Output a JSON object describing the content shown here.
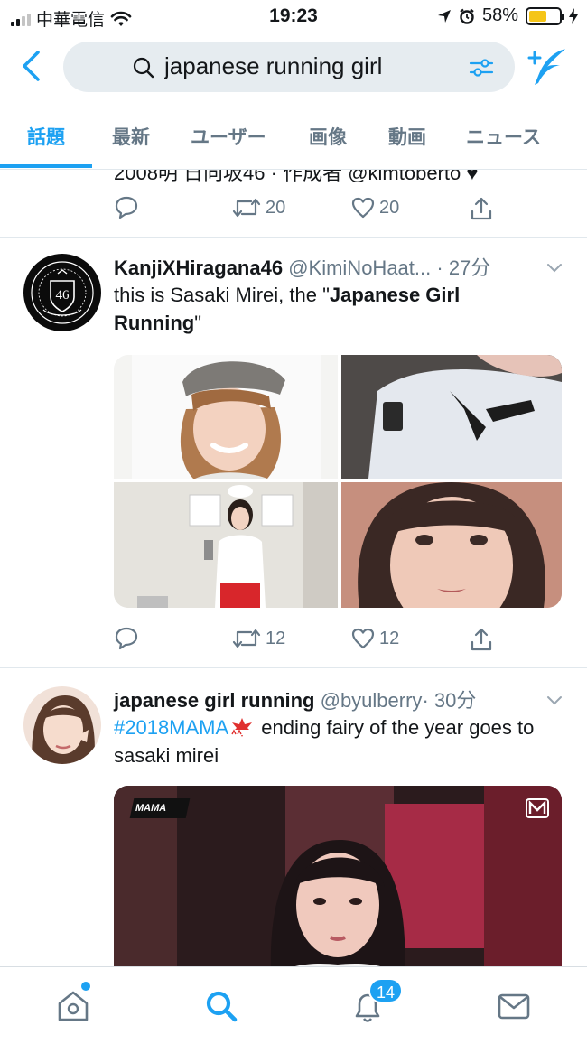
{
  "status_bar": {
    "carrier": "中華電信",
    "time": "19:23",
    "battery": "58%",
    "battery_level": 0.58
  },
  "search": {
    "query": "japanese running girl"
  },
  "tabs": [
    {
      "label": "話題",
      "active": true
    },
    {
      "label": "最新",
      "active": false
    },
    {
      "label": "ユーザー",
      "active": false
    },
    {
      "label": "画像",
      "active": false
    },
    {
      "label": "動画",
      "active": false
    },
    {
      "label": "ニュース",
      "active": false
    }
  ],
  "feed": {
    "partial_tweet": {
      "cut_text": "2008明 日向坂46 · 作成者 @kimtoberto ♥",
      "retweets": "20",
      "likes": "20"
    },
    "tweets": [
      {
        "display_name": "KanjiXHiragana46",
        "handle": "@KimiNoHaat...",
        "time": "· 27分",
        "text_before": "this is Sasaki Mirei, the \"",
        "text_bold": "Japanese Girl Running",
        "text_after": "\"",
        "retweets": "12",
        "likes": "12"
      },
      {
        "display_name": "japanese girl running",
        "handle": "@byulberry",
        "time": "· 30分",
        "hashtag": "#2018MAMA",
        "text": " ending fairy of the year goes to sasaki mirei",
        "video_logo": "MAMA"
      }
    ]
  },
  "tabbar": {
    "notifications_badge": "14"
  },
  "colors": {
    "accent": "#1da1f2",
    "muted": "#657786",
    "text": "#14171a",
    "search_bg": "#e6ecf0",
    "battery": "#f5c518"
  }
}
